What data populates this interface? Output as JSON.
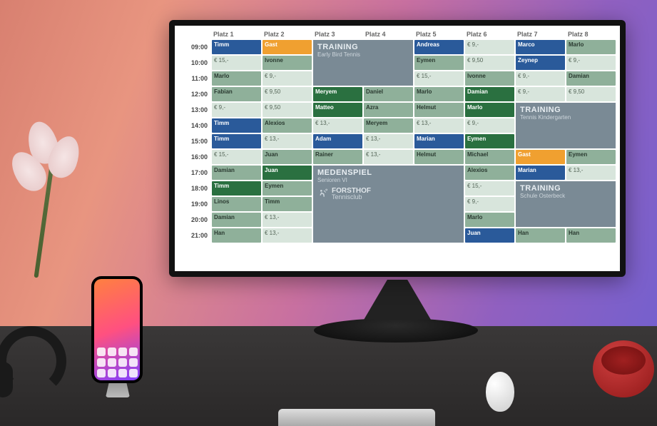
{
  "club": {
    "name": "FORSTHOF",
    "sub": "Tennisclub"
  },
  "columns": [
    "Platz 1",
    "Platz 2",
    "Platz 3",
    "Platz 4",
    "Platz 5",
    "Platz 6",
    "Platz 7",
    "Platz 8"
  ],
  "times": [
    "09:00",
    "10:00",
    "11:00",
    "12:00",
    "13:00",
    "14:00",
    "15:00",
    "16:00",
    "17:00",
    "18:00",
    "19:00",
    "20:00",
    "21:00"
  ],
  "blocks": {
    "training1": {
      "title": "TRAINING",
      "sub": "Early Bird Tennis"
    },
    "training2": {
      "title": "TRAINING",
      "sub": "Tennis Kindergarten"
    },
    "training3": {
      "title": "TRAINING",
      "sub": "Schule Osterbeck"
    },
    "meden": {
      "title": "MEDENSPIEL",
      "sub": "Senioren VI"
    }
  },
  "cells": {
    "c1r0": {
      "t": "Timm",
      "k": "blue"
    },
    "c2r0": {
      "t": "Gast",
      "k": "orange"
    },
    "c5r0": {
      "t": "Andreas",
      "k": "blue"
    },
    "c6r0": {
      "t": "€ 9,-",
      "k": "price"
    },
    "c7r0": {
      "t": "Marco",
      "k": "blue"
    },
    "c8r0": {
      "t": "Marlo",
      "k": "name"
    },
    "c1r1": {
      "t": "€ 15,-",
      "k": "price"
    },
    "c2r1": {
      "t": "Ivonne",
      "k": "name"
    },
    "c5r1": {
      "t": "Eymen",
      "k": "name"
    },
    "c6r1": {
      "t": "€ 9,50",
      "k": "price"
    },
    "c7r1": {
      "t": "Zeynep",
      "k": "blue"
    },
    "c8r1": {
      "t": "€ 9,-",
      "k": "price"
    },
    "c1r2": {
      "t": "Marlo",
      "k": "name"
    },
    "c2r2": {
      "t": "€ 9,-",
      "k": "price"
    },
    "c5r2": {
      "t": "€ 15,-",
      "k": "price"
    },
    "c6r2": {
      "t": "Ivonne",
      "k": "name"
    },
    "c7r2": {
      "t": "€ 9,-",
      "k": "price"
    },
    "c8r2": {
      "t": "Damian",
      "k": "name"
    },
    "c1r3": {
      "t": "Fabian",
      "k": "name"
    },
    "c2r3": {
      "t": "€ 9,50",
      "k": "price"
    },
    "c3r3": {
      "t": "Meryem",
      "k": "green"
    },
    "c4r3": {
      "t": "Daniel",
      "k": "name"
    },
    "c5r3": {
      "t": "Marlo",
      "k": "name"
    },
    "c6r3": {
      "t": "Damian",
      "k": "green"
    },
    "c7r3": {
      "t": "€ 9,-",
      "k": "price"
    },
    "c8r3": {
      "t": "€ 9,50",
      "k": "price"
    },
    "c1r4": {
      "t": "€ 9,-",
      "k": "price"
    },
    "c2r4": {
      "t": "€ 9,50",
      "k": "price"
    },
    "c3r4": {
      "t": "Matteo",
      "k": "green"
    },
    "c4r4": {
      "t": "Azra",
      "k": "name"
    },
    "c5r4": {
      "t": "Helmut",
      "k": "name"
    },
    "c6r4": {
      "t": "Marlo",
      "k": "green"
    },
    "c1r5": {
      "t": "Timm",
      "k": "blue"
    },
    "c2r5": {
      "t": "Alexios",
      "k": "name"
    },
    "c3r5": {
      "t": "€ 13,-",
      "k": "price"
    },
    "c4r5": {
      "t": "Meryem",
      "k": "name"
    },
    "c5r5": {
      "t": "€ 13,-",
      "k": "price"
    },
    "c6r5": {
      "t": "€ 9,-",
      "k": "price"
    },
    "c1r6": {
      "t": "Timm",
      "k": "blue"
    },
    "c2r6": {
      "t": "€ 13,-",
      "k": "price"
    },
    "c3r6": {
      "t": "Adam",
      "k": "blue"
    },
    "c4r6": {
      "t": "€ 13,-",
      "k": "price"
    },
    "c5r6": {
      "t": "Marian",
      "k": "blue"
    },
    "c6r6": {
      "t": "Eymen",
      "k": "green"
    },
    "c1r7": {
      "t": "€ 15,-",
      "k": "price"
    },
    "c2r7": {
      "t": "Juan",
      "k": "name"
    },
    "c3r7": {
      "t": "Rainer",
      "k": "name"
    },
    "c4r7": {
      "t": "€ 13,-",
      "k": "price"
    },
    "c5r7": {
      "t": "Helmut",
      "k": "name"
    },
    "c6r7": {
      "t": "Michael",
      "k": "name"
    },
    "c7r7": {
      "t": "Gast",
      "k": "orange"
    },
    "c8r7": {
      "t": "Eymen",
      "k": "name"
    },
    "c1r8": {
      "t": "Damian",
      "k": "name"
    },
    "c2r8": {
      "t": "Juan",
      "k": "green"
    },
    "c6r8": {
      "t": "Alexios",
      "k": "name"
    },
    "c7r8": {
      "t": "Marian",
      "k": "blue"
    },
    "c8r8": {
      "t": "€ 13,-",
      "k": "price"
    },
    "c1r9": {
      "t": "Timm",
      "k": "green"
    },
    "c2r9": {
      "t": "Eymen",
      "k": "name"
    },
    "c6r9": {
      "t": "€ 15,-",
      "k": "price"
    },
    "c1r10": {
      "t": "Linos",
      "k": "name"
    },
    "c2r10": {
      "t": "Timm",
      "k": "name"
    },
    "c6r10": {
      "t": "€ 9,-",
      "k": "price"
    },
    "c1r11": {
      "t": "Damian",
      "k": "name"
    },
    "c2r11": {
      "t": "€ 13,-",
      "k": "price"
    },
    "c6r11": {
      "t": "Marlo",
      "k": "name"
    },
    "c1r12": {
      "t": "Han",
      "k": "name"
    },
    "c2r12": {
      "t": "€ 13,-",
      "k": "price"
    },
    "c6r12": {
      "t": "Juan",
      "k": "blue"
    },
    "c7r12": {
      "t": "Han",
      "k": "name"
    },
    "c8r12": {
      "t": "Han",
      "k": "name"
    }
  }
}
